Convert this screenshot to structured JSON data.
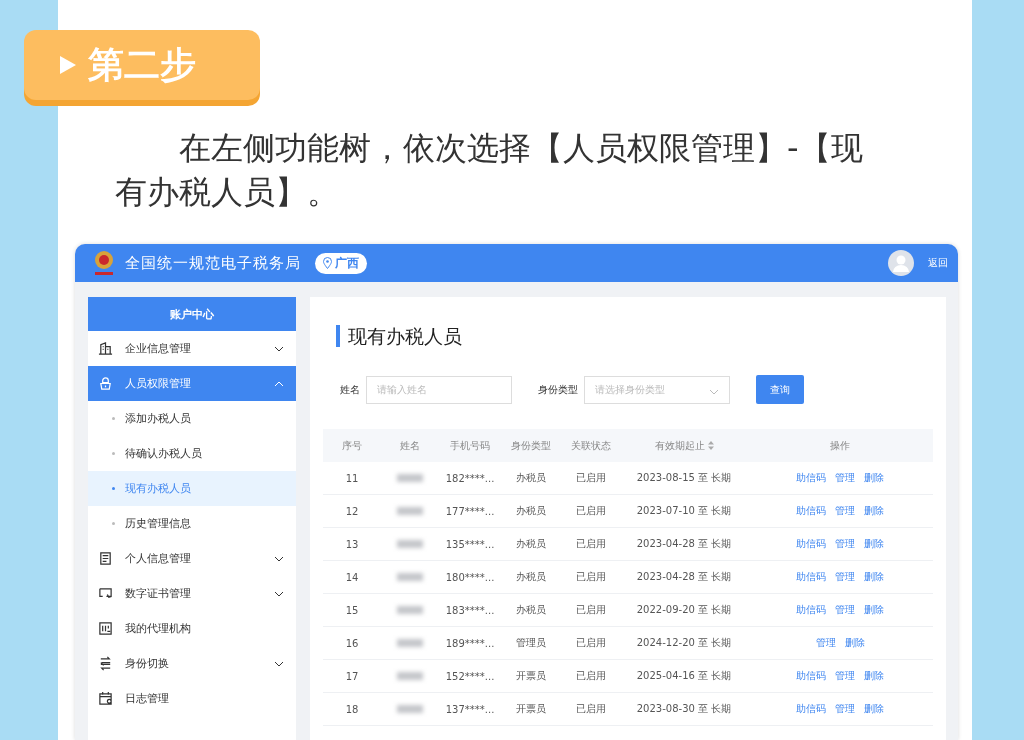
{
  "step": {
    "label": "第二步"
  },
  "instruction": "在左侧功能树，依次选择【人员权限管理】-【现有办税人员】。",
  "app": {
    "header": {
      "title": "全国统一规范电子税务局",
      "location": "广西",
      "back": "返回"
    },
    "sidebar": {
      "title": "账户中心",
      "items": [
        {
          "label": "企业信息管理",
          "selected": false,
          "expanded": false
        },
        {
          "label": "人员权限管理",
          "selected": true,
          "expanded": true,
          "children": [
            {
              "label": "添加办税人员",
              "selected": false
            },
            {
              "label": "待确认办税人员",
              "selected": false
            },
            {
              "label": "现有办税人员",
              "selected": true
            },
            {
              "label": "历史管理信息",
              "selected": false
            }
          ]
        },
        {
          "label": "个人信息管理",
          "selected": false,
          "expanded": false
        },
        {
          "label": "数字证书管理",
          "selected": false,
          "expanded": false
        },
        {
          "label": "我的代理机构",
          "selected": false
        },
        {
          "label": "身份切换",
          "selected": false,
          "expanded": false
        },
        {
          "label": "日志管理",
          "selected": false
        }
      ]
    },
    "main": {
      "title": "现有办税人员",
      "filters": {
        "name_label": "姓名",
        "name_placeholder": "请输入姓名",
        "type_label": "身份类型",
        "type_placeholder": "请选择身份类型",
        "search_button": "查询"
      },
      "table": {
        "columns": [
          {
            "label": "序号",
            "sortable": false
          },
          {
            "label": "姓名",
            "sortable": false
          },
          {
            "label": "手机号码",
            "sortable": false
          },
          {
            "label": "身份类型",
            "sortable": false
          },
          {
            "label": "关联状态",
            "sortable": false
          },
          {
            "label": "有效期起止",
            "sortable": true
          },
          {
            "label": "操作",
            "sortable": false
          }
        ],
        "rows": [
          {
            "no": "11",
            "phone": "182****...",
            "type": "办税员",
            "status": "已启用",
            "validity": "2023-08-15 至 长期",
            "actions": [
              "助信码",
              "管理",
              "删除"
            ]
          },
          {
            "no": "12",
            "phone": "177****...",
            "type": "办税员",
            "status": "已启用",
            "validity": "2023-07-10 至 长期",
            "actions": [
              "助信码",
              "管理",
              "删除"
            ]
          },
          {
            "no": "13",
            "phone": "135****...",
            "type": "办税员",
            "status": "已启用",
            "validity": "2023-04-28 至 长期",
            "actions": [
              "助信码",
              "管理",
              "删除"
            ]
          },
          {
            "no": "14",
            "phone": "180****...",
            "type": "办税员",
            "status": "已启用",
            "validity": "2023-04-28 至 长期",
            "actions": [
              "助信码",
              "管理",
              "删除"
            ]
          },
          {
            "no": "15",
            "phone": "183****...",
            "type": "办税员",
            "status": "已启用",
            "validity": "2022-09-20 至 长期",
            "actions": [
              "助信码",
              "管理",
              "删除"
            ]
          },
          {
            "no": "16",
            "phone": "189****...",
            "type": "管理员",
            "status": "已启用",
            "validity": "2024-12-20 至 长期",
            "actions": [
              "管理",
              "删除"
            ]
          },
          {
            "no": "17",
            "phone": "152****...",
            "type": "开票员",
            "status": "已启用",
            "validity": "2025-04-16 至 长期",
            "actions": [
              "助信码",
              "管理",
              "删除"
            ]
          },
          {
            "no": "18",
            "phone": "137****...",
            "type": "开票员",
            "status": "已启用",
            "validity": "2023-08-30 至 长期",
            "actions": [
              "助信码",
              "管理",
              "删除"
            ]
          }
        ]
      }
    }
  }
}
